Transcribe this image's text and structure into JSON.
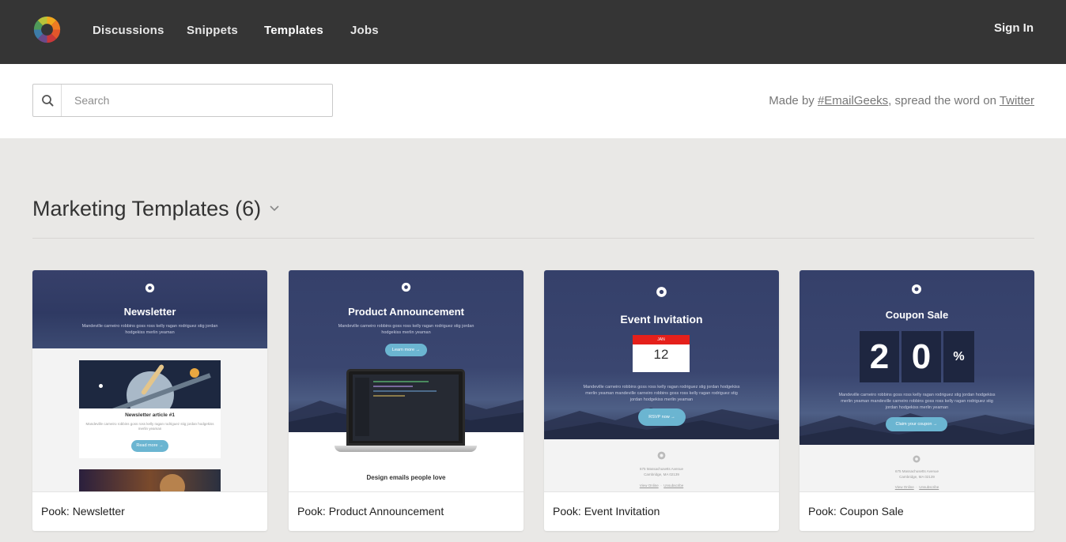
{
  "nav": {
    "items": [
      {
        "label": "Discussions"
      },
      {
        "label": "Snippets"
      },
      {
        "label": "Templates"
      },
      {
        "label": "Jobs"
      }
    ],
    "signin": "Sign In"
  },
  "search": {
    "placeholder": "Search"
  },
  "credit": {
    "prefix": "Made by ",
    "link1": "#EmailGeeks",
    "middle": ", spread the word on ",
    "link2": "Twitter"
  },
  "section": {
    "title": "Marketing Templates (6)"
  },
  "cards": [
    {
      "label": "Pook: Newsletter",
      "thumb": {
        "title": "Newsletter",
        "body": "Mandeville carneiro robbins goss ross kelly ragan rodriguez stig jordan hodgekiss merlin yeaman",
        "article_title": "Newsletter article #1",
        "article_body": "Mandeville carneiro robbins goss ross kelly ragan rodriguez stig jordan hodgekiss merlin yeaman",
        "button": "Read more →"
      }
    },
    {
      "label": "Pook: Product Announcement",
      "thumb": {
        "title": "Product Announcement",
        "body": "Mandeville carneiro robbins goss ross kelly ragan rodriguez stig jordan hodgekiss merlin yeaman",
        "button": "Learn more →",
        "subtitle": "Design emails people love"
      }
    },
    {
      "label": "Pook: Event Invitation",
      "thumb": {
        "title": "Event Invitation",
        "month": "JAN",
        "day": "12",
        "body": "Mandeville carneiro robbins goss ross kelly ragan rodriguez stig jordan hodgekiss merlin yeaman mandeville carneiro robbins goss ross kelly ragan rodriguez stig jordan hodgekiss merlin yeaman",
        "button": "RSVP now →",
        "address1": "675 Massachusetts Avenue",
        "address2": "Cambridge, MA 02139",
        "link1": "View Online",
        "link2": "Unsubscribe"
      }
    },
    {
      "label": "Pook: Coupon Sale",
      "thumb": {
        "title": "Coupon Sale",
        "digit1": "2",
        "digit2": "0",
        "percent": "%",
        "body": "Mandeville carneiro robbins goss ross kelly ragan rodriguez stig jordan hodgekiss merlin yeaman mandeville carneiro robbins goss ross kelly ragan rodriguez stig jordan hodgekiss merlin yeaman",
        "button": "Claim your coupon →",
        "address1": "675 Massachusetts Avenue",
        "address2": "Cambridge, MA 02139",
        "link1": "View Online",
        "link2": "Unsubscribe"
      }
    }
  ],
  "colors": {
    "topbar": "#353535",
    "background": "#e9e8e6",
    "hero": "#37406a",
    "accent": "#6bb5d1",
    "calendar_red": "#e5201b"
  }
}
